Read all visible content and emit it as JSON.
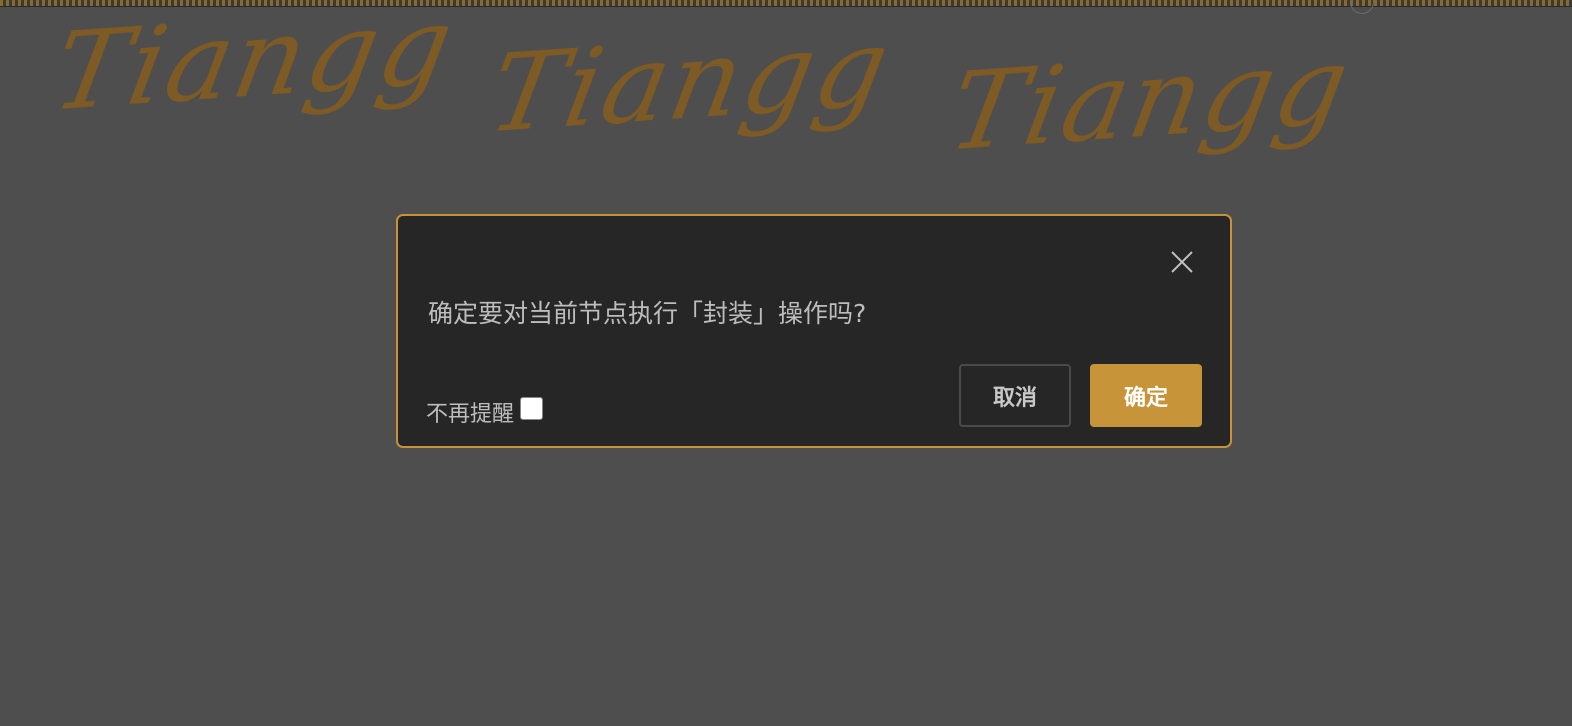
{
  "background": {
    "overlay_color": "#4e4e4e",
    "watermark_text": "Tiangg",
    "watermark_color": "#7e5a24"
  },
  "dialog": {
    "message": "确定要对当前节点执行「封装」操作吗?",
    "dont_remind_label": "不再提醒",
    "dont_remind_checked": false,
    "cancel_label": "取消",
    "confirm_label": "确定",
    "close_icon": "close-icon",
    "accent_color": "#c8943a",
    "panel_color": "#262626"
  }
}
